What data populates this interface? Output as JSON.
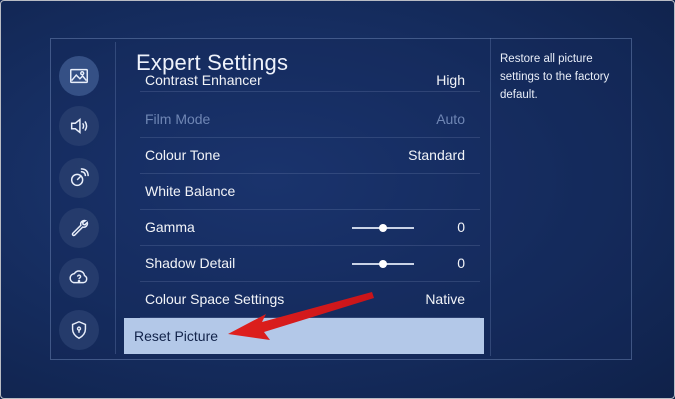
{
  "sidebar": {
    "items": [
      {
        "icon": "picture-icon",
        "active": true
      },
      {
        "icon": "sound-icon",
        "active": false
      },
      {
        "icon": "broadcast-icon",
        "active": false
      },
      {
        "icon": "wrench-icon",
        "active": false
      },
      {
        "icon": "support-icon",
        "active": false
      },
      {
        "icon": "privacy-shield-icon",
        "active": false
      }
    ]
  },
  "panel": {
    "title": "Expert Settings",
    "items": [
      {
        "label": "Contrast Enhancer",
        "value": "High",
        "state": "cut-off"
      },
      {
        "label": "Film Mode",
        "value": "Auto",
        "state": "disabled"
      },
      {
        "label": "Colour Tone",
        "value": "Standard",
        "state": "normal"
      },
      {
        "label": "White Balance",
        "value": "",
        "state": "normal"
      },
      {
        "label": "Gamma",
        "value": "0",
        "state": "normal",
        "slider_position": 0.5
      },
      {
        "label": "Shadow Detail",
        "value": "0",
        "state": "normal",
        "slider_position": 0.5
      },
      {
        "label": "Colour Space Settings",
        "value": "Native",
        "state": "normal"
      },
      {
        "label": "Reset Picture",
        "value": "",
        "state": "focused"
      }
    ]
  },
  "description": {
    "text": "Restore all picture settings to the factory default."
  },
  "colors": {
    "background": "#152c5e",
    "focus_highlight": "#b3c8e8",
    "disabled_text": "#6f86b4",
    "annotation_arrow": "#e0201d"
  }
}
